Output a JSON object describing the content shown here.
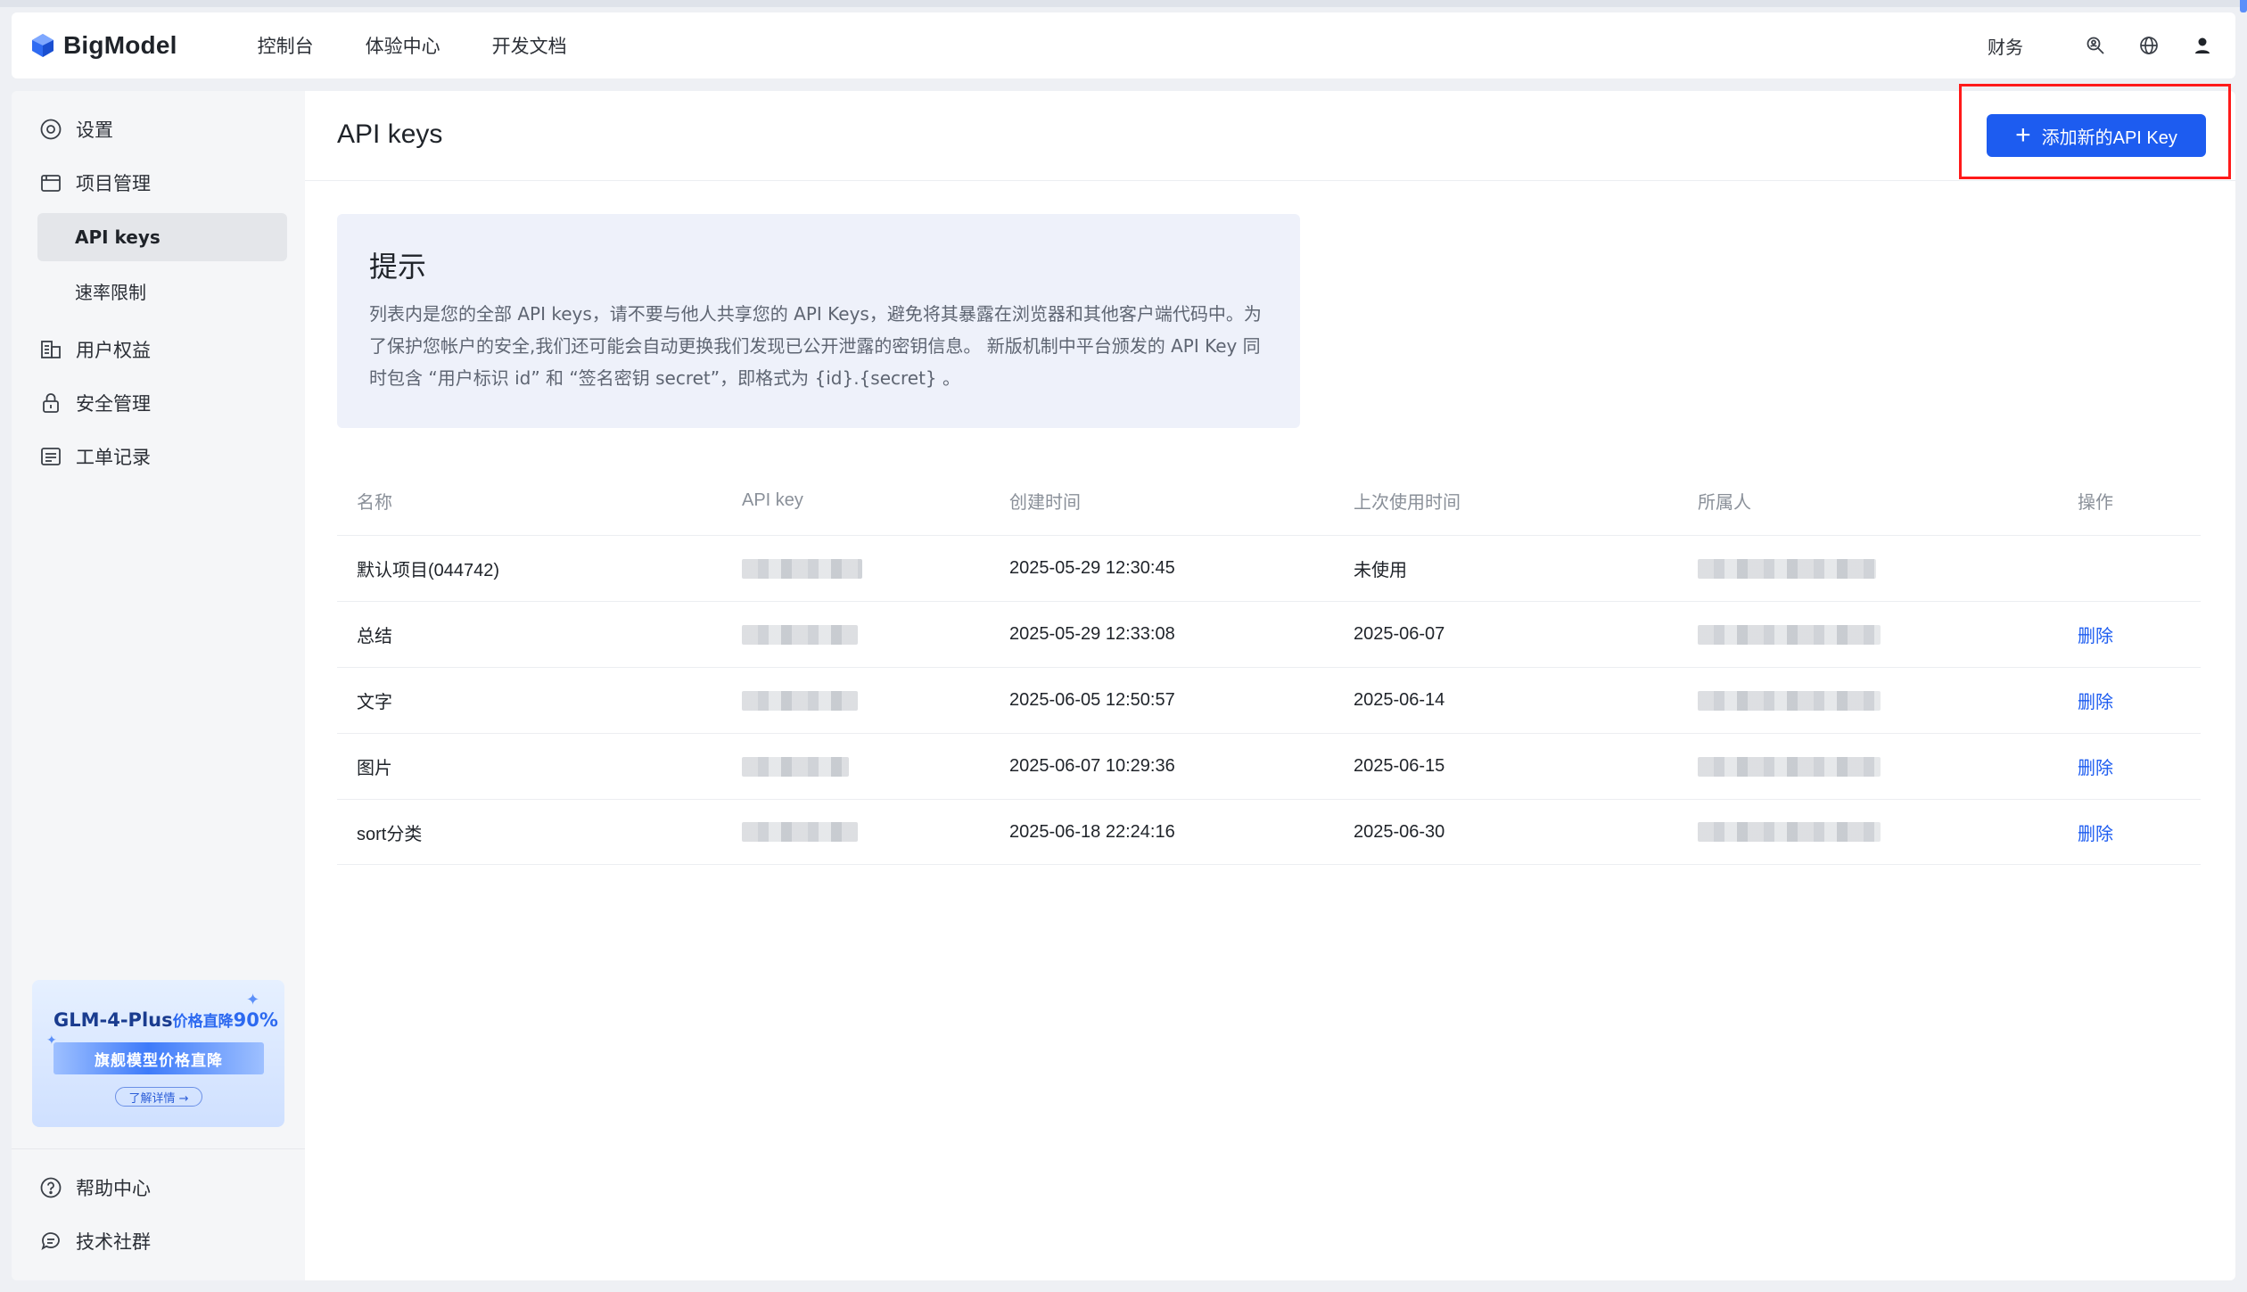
{
  "header": {
    "logo_text": "BigModel",
    "nav": [
      "控制台",
      "体验中心",
      "开发文档"
    ],
    "finance_label": "财务",
    "icons": [
      "search-person-icon",
      "globe-icon",
      "user-icon"
    ]
  },
  "sidebar": {
    "items": [
      {
        "label": "设置",
        "icon": "settings-icon"
      },
      {
        "label": "项目管理",
        "icon": "folder-icon"
      },
      {
        "label": "API keys",
        "active": true
      },
      {
        "label": "速率限制"
      },
      {
        "label": "用户权益",
        "icon": "benefits-icon"
      },
      {
        "label": "安全管理",
        "icon": "lock-icon"
      },
      {
        "label": "工单记录",
        "icon": "ticket-icon"
      }
    ],
    "promo": {
      "title_model": "GLM-4-Plus",
      "title_text": "价格直降",
      "title_pct": "90%",
      "banner": "旗舰模型价格直降",
      "button": "了解详情 →"
    },
    "footer": [
      {
        "label": "帮助中心",
        "icon": "help-icon"
      },
      {
        "label": "技术社群",
        "icon": "chat-icon"
      }
    ]
  },
  "main": {
    "title": "API keys",
    "add_button": "添加新的API Key",
    "tip": {
      "title": "提示",
      "body": "列表内是您的全部 API keys，请不要与他人共享您的 API Keys，避免将其暴露在浏览器和其他客户端代码中。为了保护您帐户的安全,我们还可能会自动更换我们发现已公开泄露的密钥信息。 新版机制中平台颁发的 API Key 同时包含 “用户标识 id” 和 “签名密钥 secret”，即格式为 {id}.{secret} 。"
    },
    "table": {
      "headers": [
        "名称",
        "API key",
        "创建时间",
        "上次使用时间",
        "所属人",
        "操作"
      ],
      "rows": [
        {
          "name": "默认项目(044742)",
          "created": "2025-05-29 12:30:45",
          "last_used": "未使用",
          "action": ""
        },
        {
          "name": "总结",
          "created": "2025-05-29 12:33:08",
          "last_used": "2025-06-07",
          "action": "删除"
        },
        {
          "name": "文字",
          "created": "2025-06-05 12:50:57",
          "last_used": "2025-06-14",
          "action": "删除"
        },
        {
          "name": "图片",
          "created": "2025-06-07 10:29:36",
          "last_used": "2025-06-15",
          "action": "删除"
        },
        {
          "name": "sort分类",
          "created": "2025-06-18 22:24:16",
          "last_used": "2025-06-30",
          "action": "删除"
        }
      ]
    }
  },
  "colors": {
    "accent": "#1d5cf0",
    "highlight": "#ff1a1a"
  }
}
